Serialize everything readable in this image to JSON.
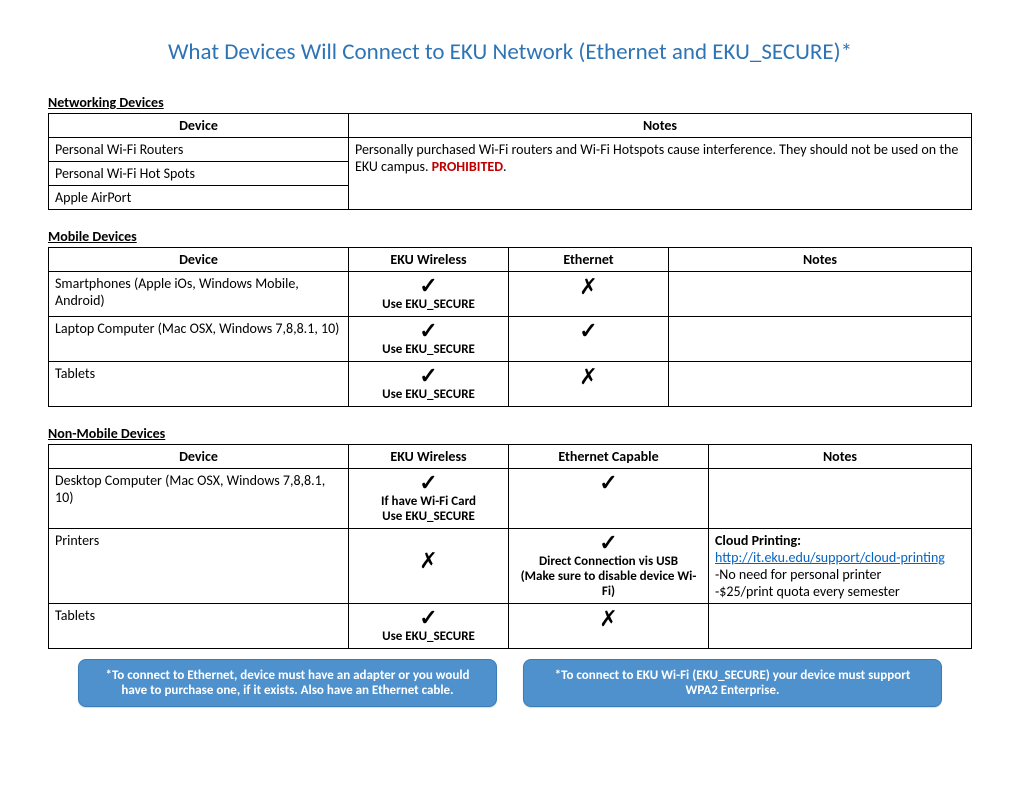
{
  "title": "What Devices Will Connect to EKU Network (Ethernet and EKU_SECURE)*",
  "sections": {
    "networking": {
      "heading": "Networking Devices",
      "headers": {
        "device": "Device",
        "notes": "Notes"
      },
      "rows": {
        "r1": "Personal Wi-Fi Routers",
        "r2": "Personal Wi-Fi Hot Spots",
        "r3": "Apple AirPort"
      },
      "notes_line1": "Personally purchased Wi-Fi routers and Wi-Fi Hotspots cause interference.  They should not be used on the EKU campus. ",
      "notes_red": "PROHIBITED",
      "notes_period": "."
    },
    "mobile": {
      "heading": "Mobile Devices",
      "headers": {
        "device": "Device",
        "wireless": "EKU Wireless",
        "ethernet": "Ethernet",
        "notes": "Notes"
      },
      "rows": {
        "r1": {
          "device": "Smartphones (Apple iOs, Windows Mobile, Android)",
          "wireless_sub": "Use EKU_SECURE"
        },
        "r2": {
          "device": "Laptop Computer (Mac OSX, Windows 7,8,8.1, 10)",
          "wireless_sub": "Use EKU_SECURE"
        },
        "r3": {
          "device": "Tablets",
          "wireless_sub": "Use EKU_SECURE"
        }
      }
    },
    "nonmobile": {
      "heading": "Non-Mobile Devices",
      "headers": {
        "device": "Device",
        "wireless": "EKU Wireless",
        "ethernet": "Ethernet Capable",
        "notes": "Notes"
      },
      "rows": {
        "r1": {
          "device": "Desktop Computer (Mac OSX, Windows 7,8,8.1, 10)",
          "wireless_sub1": "If have Wi-Fi Card",
          "wireless_sub2": "Use EKU_SECURE"
        },
        "r2": {
          "device": "Printers",
          "ethernet_sub1": "Direct Connection vis USB",
          "ethernet_sub2": "(Make sure to disable device Wi-Fi)",
          "notes_title": "Cloud Printing:",
          "notes_link_text": "http://it.eku.edu/support/cloud-printing",
          "notes_link_href": "http://it.eku.edu/support/cloud-printing",
          "notes_b1": "-No need for personal printer",
          "notes_b2": "-$25/print quota every semester"
        },
        "r3": {
          "device": "Tablets",
          "wireless_sub": "Use EKU_SECURE"
        }
      }
    }
  },
  "callouts": {
    "left": "*To connect to Ethernet, device must have an adapter or you would have to purchase one, if it exists.  Also have an Ethernet cable.",
    "right": "*To connect to EKU Wi-Fi (EKU_SECURE) your device must support WPA2 Enterprise."
  },
  "symbols": {
    "check": "✓",
    "cross": "✗"
  }
}
